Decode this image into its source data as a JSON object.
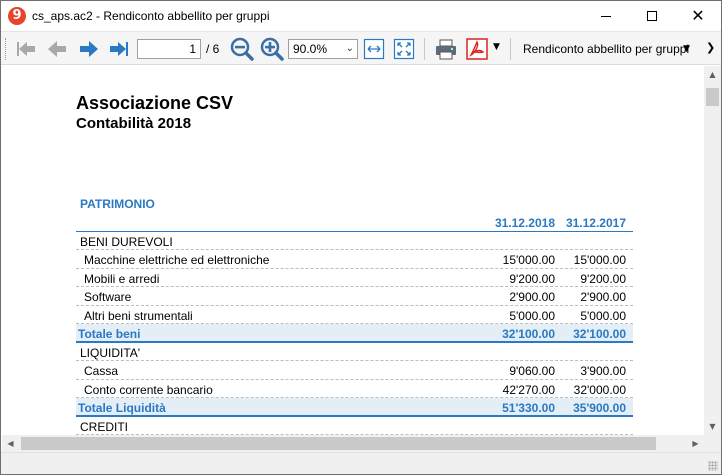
{
  "window": {
    "title": "cs_aps.ac2 - Rendiconto abbellito per gruppi",
    "app_icon_label": "9"
  },
  "toolbar": {
    "page_current": "1",
    "page_total": "/ 6",
    "zoom": "90.0%",
    "report_name": "Rendiconto abbellito per gruppi",
    "colors": {
      "nav_arrow": "#2a79c2",
      "nav_arrow_disabled": "#a8a8a8",
      "pdf": "#d9261c"
    }
  },
  "report": {
    "org_name": "Associazione CSV",
    "subtitle": "Contabilità 2018",
    "section": "PATRIMONIO",
    "col1_header": "31.12.2018",
    "col2_header": "31.12.2017",
    "rows": [
      {
        "kind": "group",
        "label": "BENI DUREVOLI",
        "v1": "",
        "v2": ""
      },
      {
        "kind": "detail",
        "label": "Macchine elettriche ed elettroniche",
        "v1": "15'000.00",
        "v2": "15'000.00"
      },
      {
        "kind": "detail",
        "label": "Mobili e arredi",
        "v1": "9'200.00",
        "v2": "9'200.00"
      },
      {
        "kind": "detail",
        "label": "Software",
        "v1": "2'900.00",
        "v2": "2'900.00"
      },
      {
        "kind": "detail",
        "label": "Altri beni strumentali",
        "v1": "5'000.00",
        "v2": "5'000.00"
      },
      {
        "kind": "total",
        "label": "Totale beni",
        "v1": "32'100.00",
        "v2": "32'100.00"
      },
      {
        "kind": "group",
        "label": "LIQUIDITA'",
        "v1": "",
        "v2": ""
      },
      {
        "kind": "detail",
        "label": "Cassa",
        "v1": "9'060.00",
        "v2": "3'900.00"
      },
      {
        "kind": "detail",
        "label": "Conto corrente bancario",
        "v1": "42'270.00",
        "v2": "32'000.00"
      },
      {
        "kind": "total",
        "label": "Totale Liquidità",
        "v1": "51'330.00",
        "v2": "35'900.00"
      },
      {
        "kind": "group",
        "label": "CREDITI",
        "v1": "",
        "v2": ""
      }
    ],
    "accent_color": "#2a79c2",
    "total_row_bg": "#e3eef7"
  }
}
